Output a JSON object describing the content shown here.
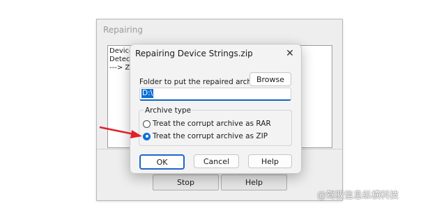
{
  "background_window": {
    "title": "Repairing",
    "log_lines": [
      "Device",
      "Detecti",
      "---> ZI"
    ],
    "stop_label": "Stop",
    "help_label": "Help"
  },
  "dialog": {
    "title": "Repairing Device Strings.zip",
    "close_glyph": "✕",
    "folder_label": "Folder to put the repaired archive",
    "browse_label": "Browse",
    "path_value": "D:\\",
    "group_label": "Archive type",
    "options": [
      {
        "label": "Treat the corrupt archive as RAR",
        "selected": false
      },
      {
        "label": "Treat the corrupt archive as ZIP",
        "selected": true
      }
    ],
    "ok_label": "OK",
    "cancel_label": "Cancel",
    "help_label": "Help"
  },
  "annotation": {
    "arrow_color": "#e0202a"
  },
  "watermark": "@驾驭信息纵横科技"
}
